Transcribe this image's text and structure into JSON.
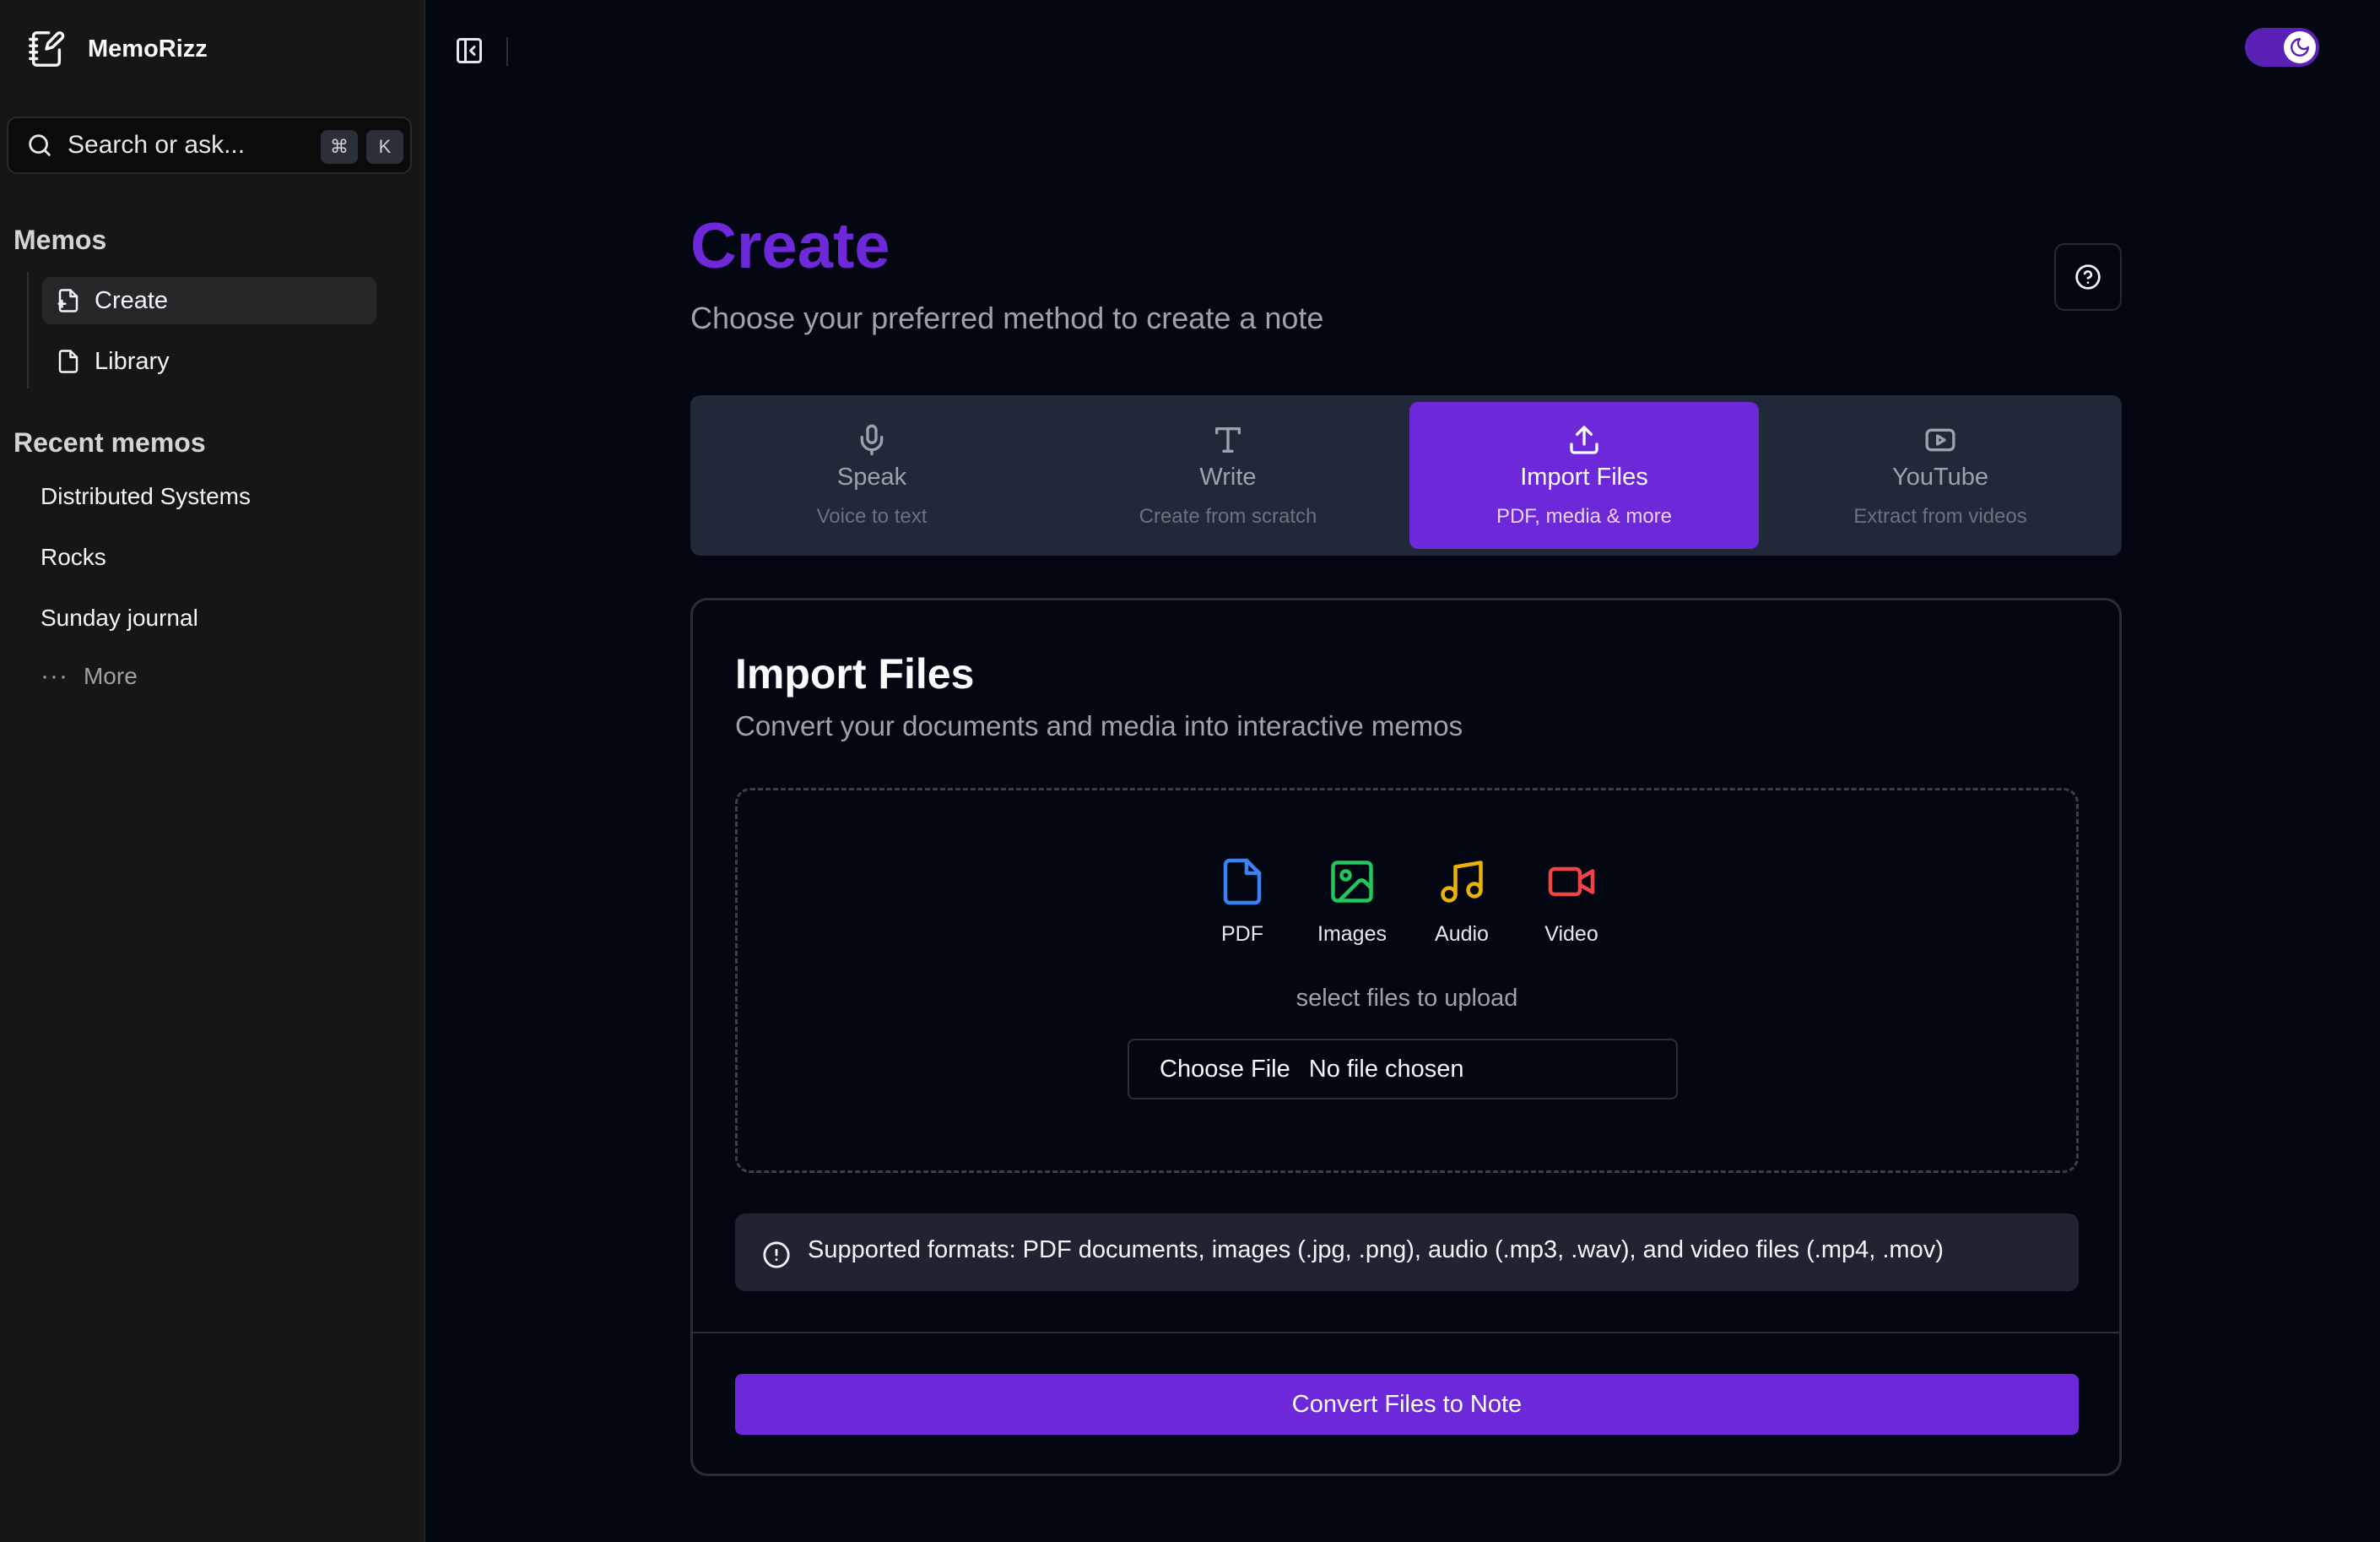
{
  "app": {
    "name": "MemoRizz"
  },
  "search": {
    "placeholder": "Search or ask...",
    "shortcut_key1": "⌘",
    "shortcut_key2": "K"
  },
  "sidebar": {
    "memos_title": "Memos",
    "nav": [
      {
        "label": "Create",
        "icon": "file-plus-icon",
        "active": true
      },
      {
        "label": "Library",
        "icon": "file-icon",
        "active": false
      }
    ],
    "recent_title": "Recent memos",
    "recent": [
      "Distributed Systems",
      "Rocks",
      "Sunday journal"
    ],
    "more_label": "More"
  },
  "header": {
    "title": "Create",
    "subtitle": "Choose your preferred method to create a note"
  },
  "tabs": [
    {
      "label": "Speak",
      "sub": "Voice to text",
      "icon": "mic-icon",
      "active": false
    },
    {
      "label": "Write",
      "sub": "Create from scratch",
      "icon": "type-icon",
      "active": false
    },
    {
      "label": "Import Files",
      "sub": "PDF, media & more",
      "icon": "upload-icon",
      "active": true
    },
    {
      "label": "YouTube",
      "sub": "Extract from videos",
      "icon": "youtube-icon",
      "active": false
    }
  ],
  "import": {
    "title": "Import Files",
    "subtitle": "Convert your documents and media into interactive memos",
    "file_types": [
      {
        "label": "PDF",
        "icon": "pdf-file-icon",
        "color": "#3b82f6"
      },
      {
        "label": "Images",
        "icon": "image-icon",
        "color": "#22c55e"
      },
      {
        "label": "Audio",
        "icon": "music-icon",
        "color": "#eab308"
      },
      {
        "label": "Video",
        "icon": "video-icon",
        "color": "#ef4444"
      }
    ],
    "hint": "select files to upload",
    "choose_button": "Choose File",
    "no_file": "No file chosen",
    "info": "Supported formats: PDF documents, images (.jpg, .png), audio (.mp3, .wav), and video files (.mp4, .mov)",
    "convert_button": "Convert Files to Note"
  },
  "colors": {
    "accent": "#6d28d9",
    "background": "#030711",
    "sidebar": "#161616"
  }
}
